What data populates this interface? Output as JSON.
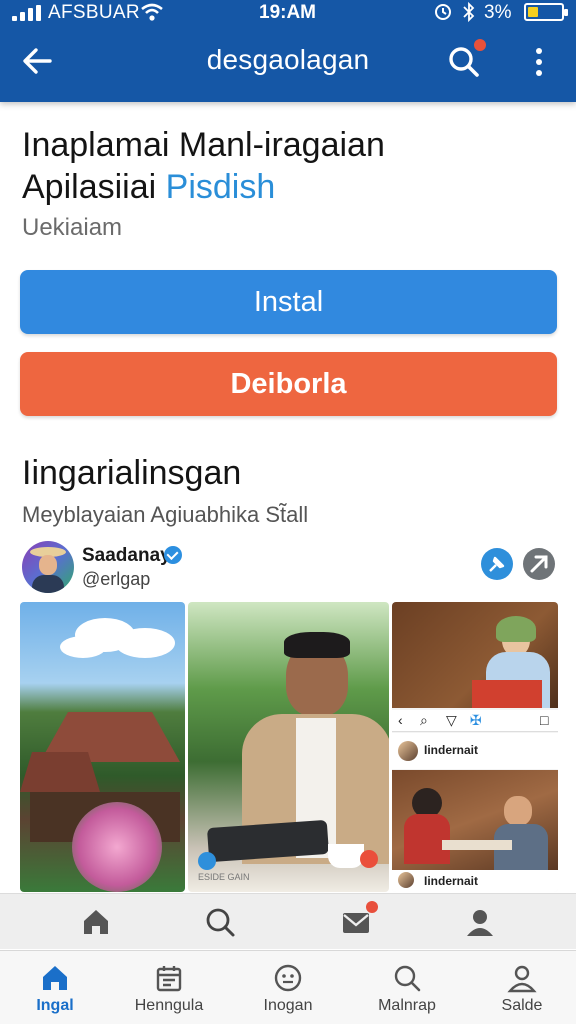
{
  "status_bar": {
    "carrier": "AFSBUAR",
    "time": "19:AM",
    "battery_pct": "3%",
    "battery_level": 0.3,
    "icons": [
      "signal-icon",
      "wifi-icon",
      "alarm-icon",
      "bluetooth-icon",
      "battery-icon"
    ]
  },
  "app_bar": {
    "title": "desgaolagan",
    "icons": [
      "back-arrow-icon",
      "search-icon",
      "more-vertical-icon"
    ],
    "color": "#1557a6"
  },
  "main": {
    "headline_line1": "Inaplamai Manl-iragaian",
    "headline_line2": "Apilasiiai",
    "headline_accent": "Pisdish",
    "subline": "Uekiaiam",
    "install_label": "Instal",
    "secondary_label": "Deiborla",
    "section_title": "Iingarialinsgan",
    "section_subtitle": "Meyblayaian Agiuabhika St̃all"
  },
  "post": {
    "user_name": "Saadanay",
    "user_handle": "@erlgap",
    "photo_caption": "ESIDE GAIN",
    "nested_post_name_1": "Iindernait",
    "nested_post_name_2": "Iindernait"
  },
  "toolbar": {
    "icons": [
      "home-icon",
      "search-icon",
      "mail-icon",
      "person-icon"
    ],
    "mail_badge": true
  },
  "tabbar": {
    "tabs": [
      {
        "label": "Ingal",
        "icon": "home-icon",
        "active": true
      },
      {
        "label": "Henngula",
        "icon": "calendar-icon",
        "active": false
      },
      {
        "label": "Inogan",
        "icon": "face-icon",
        "active": false
      },
      {
        "label": "Malnrap",
        "icon": "search-icon",
        "active": false
      },
      {
        "label": "Salde",
        "icon": "person-icon",
        "active": false
      }
    ]
  },
  "colors": {
    "primary": "#1557a6",
    "install_button": "#3189df",
    "secondary_button": "#ee6640",
    "accent_text": "#2a8ed8",
    "active_tab": "#1a6fc9"
  }
}
